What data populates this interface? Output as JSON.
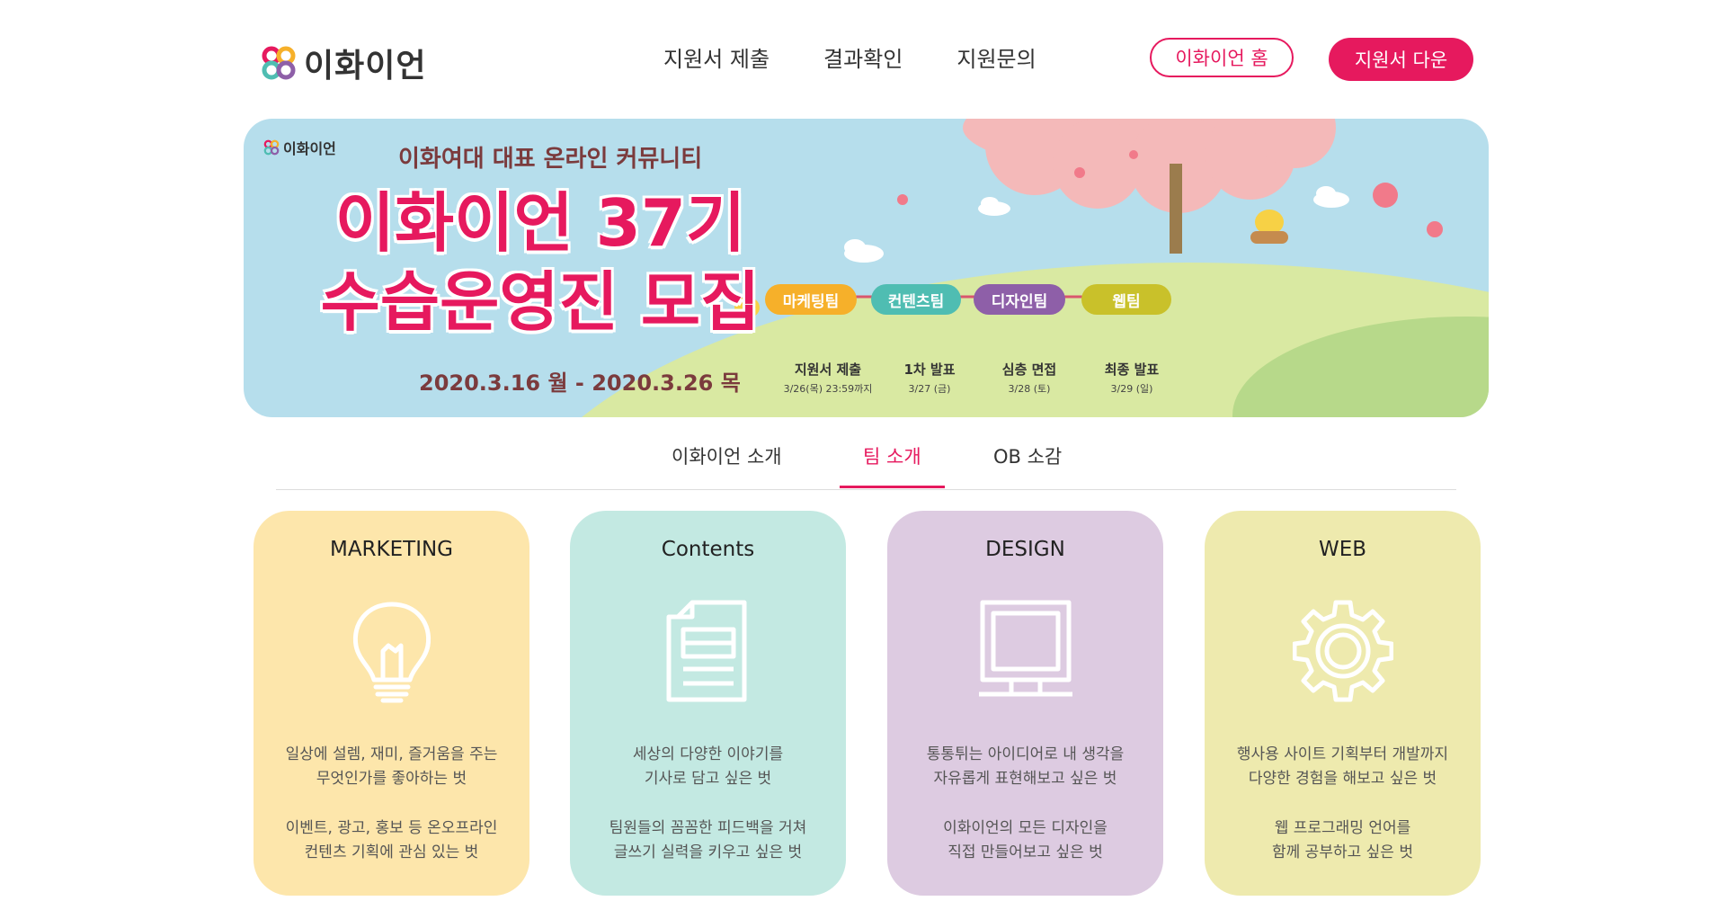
{
  "header": {
    "logo_text": "이화이언",
    "nav": [
      "지원서 제출",
      "결과확인",
      "지원문의"
    ],
    "home_button": "이화이언 홈",
    "download_button": "지원서 다운",
    "accent_color": "#e6195e"
  },
  "banner": {
    "logo_text": "이화이언",
    "subtitle": "이화여대 대표 온라인 커뮤니티",
    "title_line1": "이화이언 37기",
    "title_line2": "수습운영진 모집",
    "date_range": "2020.3.16 월 - 2020.3.26 목",
    "teams": [
      {
        "label": "마케팅팀",
        "color": "#f6b02a"
      },
      {
        "label": "컨텐츠팀",
        "color": "#4fbdb2"
      },
      {
        "label": "디자인팀",
        "color": "#8e5fa8"
      },
      {
        "label": "웹팀",
        "color": "#c9c12a"
      }
    ],
    "timeline": [
      {
        "label": "지원서 제출",
        "date": "3/26(목) 23:59까지"
      },
      {
        "label": "1차 발표",
        "date": "3/27 (금)"
      },
      {
        "label": "심층 면접",
        "date": "3/28 (토)"
      },
      {
        "label": "최종 발표",
        "date": "3/29 (일)"
      }
    ]
  },
  "tabs": {
    "items": [
      "이화이언 소개",
      "팀 소개",
      "OB 소감"
    ],
    "active": "팀 소개"
  },
  "cards": [
    {
      "title": "MARKETING",
      "icon": "lightbulb-icon",
      "bg": "#fde6ab",
      "text1": [
        "일상에 설렘, 재미, 즐거움을 주는",
        "무엇인가를 좋아하는 벗"
      ],
      "text2": [
        "이벤트, 광고, 홍보 등 온오프라인",
        "컨텐츠 기획에 관심 있는 벗"
      ]
    },
    {
      "title": "Contents",
      "icon": "document-icon",
      "bg": "#c3e9e2",
      "text1": [
        "세상의 다양한 이야기를",
        "기사로 담고 싶은 벗"
      ],
      "text2": [
        "팀원들의 꼼꼼한 피드백을 거쳐",
        "글쓰기 실력을 키우고 싶은 벗"
      ]
    },
    {
      "title": "DESIGN",
      "icon": "monitor-icon",
      "bg": "#ddcbe1",
      "text1": [
        "통통튀는 아이디어로 내 생각을",
        "자유롭게 표현해보고 싶은 벗"
      ],
      "text2": [
        "이화이언의 모든 디자인을",
        "직접 만들어보고 싶은 벗"
      ]
    },
    {
      "title": "WEB",
      "icon": "gear-icon",
      "bg": "#eeeaae",
      "text1": [
        "행사용 사이트 기획부터 개발까지",
        "다양한 경험을 해보고 싶은 벗"
      ],
      "text2": [
        "웹 프로그래밍 언어를",
        "함께 공부하고 싶은 벗"
      ]
    }
  ]
}
